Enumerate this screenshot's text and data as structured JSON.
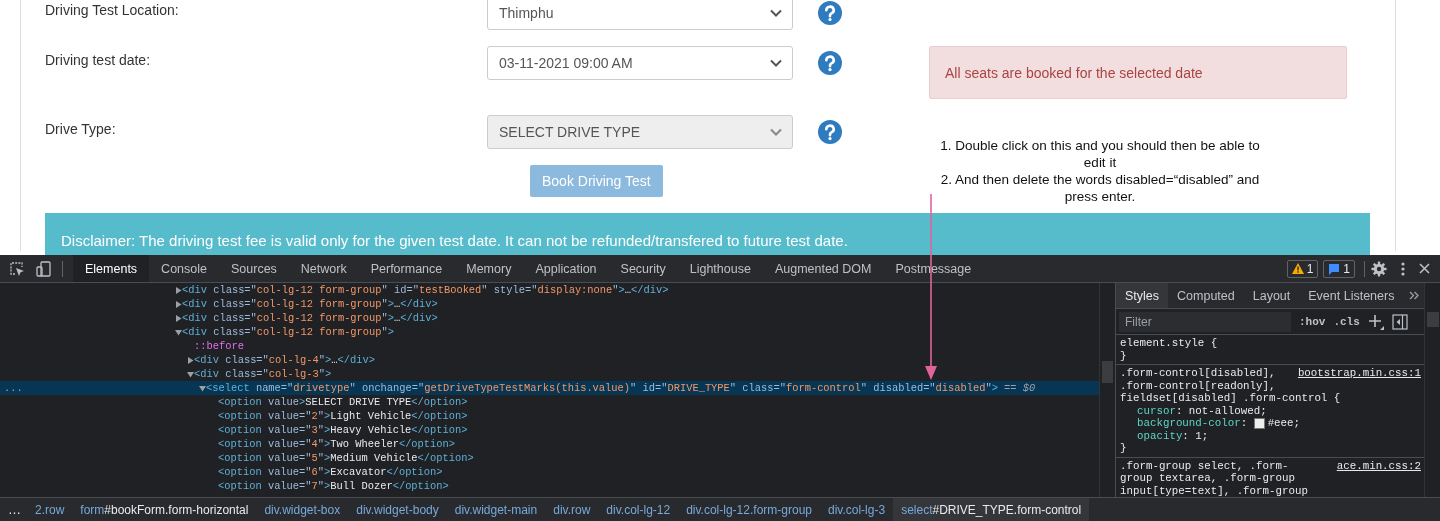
{
  "form": {
    "rows": [
      {
        "label": "Driving Test Location:",
        "value": "Thimphu",
        "disabled": false
      },
      {
        "label": "Driving test date:",
        "value": "03-11-2021 09:00 AM",
        "disabled": false,
        "alert": "All seats are booked for the selected date"
      },
      {
        "label": "Drive Type:",
        "value": "SELECT DRIVE TYPE",
        "disabled": true
      }
    ],
    "submit_button": "Book Driving Test",
    "disclaimer": "Disclaimer: The driving test fee is valid only for the given test date. It can not be refunded/transfered to future test date."
  },
  "annotation": {
    "steps": [
      "1. Double click on this and you should then be able to edit it",
      "2. And then delete the words disabled=“disabled” and press enter."
    ]
  },
  "devtools": {
    "tabs": [
      {
        "label": "Elements",
        "selected": true
      },
      {
        "label": "Console",
        "selected": false
      },
      {
        "label": "Sources",
        "selected": false
      },
      {
        "label": "Network",
        "selected": false
      },
      {
        "label": "Performance",
        "selected": false
      },
      {
        "label": "Memory",
        "selected": false
      },
      {
        "label": "Application",
        "selected": false
      },
      {
        "label": "Security",
        "selected": false
      },
      {
        "label": "Lighthouse",
        "selected": false
      },
      {
        "label": "Augmented DOM",
        "selected": false
      },
      {
        "label": "Postmessage",
        "selected": false
      }
    ],
    "warnings": "1",
    "messages": "1",
    "dom_tree": [
      {
        "selected": false,
        "expanded": false,
        "tokens": [
          {
            "kind": "tag",
            "text": "<div"
          },
          {
            "kind": "attr",
            "text": " class=\""
          },
          {
            "kind": "value",
            "text": "col-lg-12 form-group"
          },
          {
            "kind": "attr",
            "text": "\" id=\""
          },
          {
            "kind": "value",
            "text": "testBooked"
          },
          {
            "kind": "attr",
            "text": "\" style=\""
          },
          {
            "kind": "value",
            "text": "display:none"
          },
          {
            "kind": "attr",
            "text": "\""
          },
          {
            "kind": "tag",
            "text": ">"
          },
          {
            "kind": "text",
            "text": "…"
          },
          {
            "kind": "tag",
            "text": "</div>"
          }
        ]
      },
      {
        "selected": false,
        "expanded": false,
        "tokens": [
          {
            "kind": "tag",
            "text": "<div"
          },
          {
            "kind": "attr",
            "text": " class=\""
          },
          {
            "kind": "value",
            "text": "col-lg-12 form-group"
          },
          {
            "kind": "attr",
            "text": "\""
          },
          {
            "kind": "tag",
            "text": ">"
          },
          {
            "kind": "text",
            "text": "…"
          },
          {
            "kind": "tag",
            "text": "</div>"
          }
        ]
      },
      {
        "selected": false,
        "expanded": false,
        "tokens": [
          {
            "kind": "tag",
            "text": "<div"
          },
          {
            "kind": "attr",
            "text": " class=\""
          },
          {
            "kind": "value",
            "text": "col-lg-12 form-group"
          },
          {
            "kind": "attr",
            "text": "\""
          },
          {
            "kind": "tag",
            "text": ">"
          },
          {
            "kind": "text",
            "text": "…"
          },
          {
            "kind": "tag",
            "text": "</div>"
          }
        ]
      },
      {
        "selected": false,
        "expanded": true,
        "tokens": [
          {
            "kind": "tag",
            "text": "<div"
          },
          {
            "kind": "attr",
            "text": " class=\""
          },
          {
            "kind": "value",
            "text": "col-lg-12 form-group"
          },
          {
            "kind": "attr",
            "text": "\""
          },
          {
            "kind": "tag",
            "text": ">"
          }
        ],
        "children": [
          {
            "selected": false,
            "tokens": [
              {
                "kind": "pseudo",
                "text": "::before"
              }
            ]
          },
          {
            "selected": false,
            "expanded": false,
            "tokens": [
              {
                "kind": "tag",
                "text": "<div"
              },
              {
                "kind": "attr",
                "text": " class=\""
              },
              {
                "kind": "value",
                "text": "col-lg-4"
              },
              {
                "kind": "attr",
                "text": "\""
              },
              {
                "kind": "tag",
                "text": ">"
              },
              {
                "kind": "text",
                "text": "…"
              },
              {
                "kind": "tag",
                "text": "</div>"
              }
            ]
          },
          {
            "selected": false,
            "expanded": true,
            "tokens": [
              {
                "kind": "tag",
                "text": "<div"
              },
              {
                "kind": "attr",
                "text": " class=\""
              },
              {
                "kind": "value",
                "text": "col-lg-3"
              },
              {
                "kind": "attr",
                "text": "\""
              },
              {
                "kind": "tag",
                "text": ">"
              }
            ],
            "children": [
              {
                "selected": true,
                "expanded": true,
                "gutter": "...",
                "ref": "== $0",
                "tokens": [
                  {
                    "kind": "tag",
                    "text": "<select"
                  },
                  {
                    "kind": "attr",
                    "text": " name=\""
                  },
                  {
                    "kind": "value",
                    "text": "drivetype"
                  },
                  {
                    "kind": "attr",
                    "text": "\" onchange=\""
                  },
                  {
                    "kind": "value",
                    "text": "getDriveTypeTestMarks(this.value)"
                  },
                  {
                    "kind": "attr",
                    "text": "\" id=\""
                  },
                  {
                    "kind": "value",
                    "text": "DRIVE_TYPE"
                  },
                  {
                    "kind": "attr",
                    "text": "\" class=\""
                  },
                  {
                    "kind": "value",
                    "text": "form-control"
                  },
                  {
                    "kind": "attr",
                    "text": "\" disabled=\""
                  },
                  {
                    "kind": "value",
                    "text": "disabled"
                  },
                  {
                    "kind": "attr",
                    "text": "\""
                  },
                  {
                    "kind": "tag",
                    "text": ">"
                  }
                ],
                "children": [
                  {
                    "selected": false,
                    "tokens": [
                      {
                        "kind": "tag",
                        "text": "<option"
                      },
                      {
                        "kind": "attr",
                        "text": " value"
                      },
                      {
                        "kind": "tag",
                        "text": ">"
                      },
                      {
                        "kind": "text",
                        "text": "SELECT DRIVE TYPE"
                      },
                      {
                        "kind": "tag",
                        "text": "</option>"
                      }
                    ]
                  },
                  {
                    "selected": false,
                    "tokens": [
                      {
                        "kind": "tag",
                        "text": "<option"
                      },
                      {
                        "kind": "attr",
                        "text": " value=\""
                      },
                      {
                        "kind": "value",
                        "text": "2"
                      },
                      {
                        "kind": "attr",
                        "text": "\""
                      },
                      {
                        "kind": "tag",
                        "text": ">"
                      },
                      {
                        "kind": "text",
                        "text": "Light Vehicle"
                      },
                      {
                        "kind": "tag",
                        "text": "</option>"
                      }
                    ]
                  },
                  {
                    "selected": false,
                    "tokens": [
                      {
                        "kind": "tag",
                        "text": "<option"
                      },
                      {
                        "kind": "attr",
                        "text": " value=\""
                      },
                      {
                        "kind": "value",
                        "text": "3"
                      },
                      {
                        "kind": "attr",
                        "text": "\""
                      },
                      {
                        "kind": "tag",
                        "text": ">"
                      },
                      {
                        "kind": "text",
                        "text": "Heavy Vehicle"
                      },
                      {
                        "kind": "tag",
                        "text": "</option>"
                      }
                    ]
                  },
                  {
                    "selected": false,
                    "tokens": [
                      {
                        "kind": "tag",
                        "text": "<option"
                      },
                      {
                        "kind": "attr",
                        "text": " value=\""
                      },
                      {
                        "kind": "value",
                        "text": "4"
                      },
                      {
                        "kind": "attr",
                        "text": "\""
                      },
                      {
                        "kind": "tag",
                        "text": ">"
                      },
                      {
                        "kind": "text",
                        "text": "Two Wheeler"
                      },
                      {
                        "kind": "tag",
                        "text": "</option>"
                      }
                    ]
                  },
                  {
                    "selected": false,
                    "tokens": [
                      {
                        "kind": "tag",
                        "text": "<option"
                      },
                      {
                        "kind": "attr",
                        "text": " value=\""
                      },
                      {
                        "kind": "value",
                        "text": "5"
                      },
                      {
                        "kind": "attr",
                        "text": "\""
                      },
                      {
                        "kind": "tag",
                        "text": ">"
                      },
                      {
                        "kind": "text",
                        "text": "Medium Vehicle"
                      },
                      {
                        "kind": "tag",
                        "text": "</option>"
                      }
                    ]
                  },
                  {
                    "selected": false,
                    "tokens": [
                      {
                        "kind": "tag",
                        "text": "<option"
                      },
                      {
                        "kind": "attr",
                        "text": " value=\""
                      },
                      {
                        "kind": "value",
                        "text": "6"
                      },
                      {
                        "kind": "attr",
                        "text": "\""
                      },
                      {
                        "kind": "tag",
                        "text": ">"
                      },
                      {
                        "kind": "text",
                        "text": "Excavator"
                      },
                      {
                        "kind": "tag",
                        "text": "</option>"
                      }
                    ]
                  },
                  {
                    "selected": false,
                    "tokens": [
                      {
                        "kind": "tag",
                        "text": "<option"
                      },
                      {
                        "kind": "attr",
                        "text": " value=\""
                      },
                      {
                        "kind": "value",
                        "text": "7"
                      },
                      {
                        "kind": "attr",
                        "text": "\""
                      },
                      {
                        "kind": "tag",
                        "text": ">"
                      },
                      {
                        "kind": "text",
                        "text": "Bull Dozer"
                      },
                      {
                        "kind": "tag",
                        "text": "</option>"
                      }
                    ]
                  }
                ]
              }
            ]
          }
        ]
      }
    ],
    "styles": {
      "tabs": [
        {
          "label": "Styles",
          "selected": true
        },
        {
          "label": "Computed",
          "selected": false
        },
        {
          "label": "Layout",
          "selected": false
        },
        {
          "label": "Event Listeners",
          "selected": false
        }
      ],
      "filter_placeholder": "Filter",
      "hov": ":hov",
      "cls": ".cls",
      "rules": [
        {
          "selector_lines": [
            "element.style {"
          ],
          "close": "}"
        },
        {
          "selector_lines": [
            ".form-control[disabled],",
            ".form-control[readonly],",
            "fieldset[disabled] .form-control {"
          ],
          "source": "bootstrap.min.css:1",
          "props": [
            {
              "kind": "keyword",
              "name": "cursor",
              "colon": ": ",
              "value": "not-allowed;"
            },
            {
              "kind": "color",
              "name": "background-color",
              "colon": ": ",
              "value": "#eee;"
            },
            {
              "kind": "keyword",
              "name": "opacity",
              "colon": ": ",
              "value": "1;"
            }
          ],
          "close": "}"
        },
        {
          "selector_lines": [
            ".form-group select, .form-",
            "group textarea, .form-group",
            "input[type=text], .form-group"
          ],
          "source": "ace.min.css:2"
        }
      ]
    },
    "breadcrumbs": {
      "overflow": "…",
      "items": [
        {
          "tag": "2.row",
          "selected": false
        },
        {
          "tag": "form",
          "rest": "#bookForm.form-horizontal",
          "selected": false
        },
        {
          "tag": "div.widget-box",
          "selected": false
        },
        {
          "tag": "div.widget-body",
          "selected": false
        },
        {
          "tag": "div.widget-main",
          "selected": false
        },
        {
          "tag": "div.row",
          "selected": false
        },
        {
          "tag": "div.col-lg-12",
          "selected": false
        },
        {
          "tag": "div.col-lg-12.form-group",
          "selected": false
        },
        {
          "tag": "div.col-lg-3",
          "selected": false
        },
        {
          "tag": "select",
          "rest": "#DRIVE_TYPE.form-control",
          "selected": true
        }
      ]
    }
  }
}
